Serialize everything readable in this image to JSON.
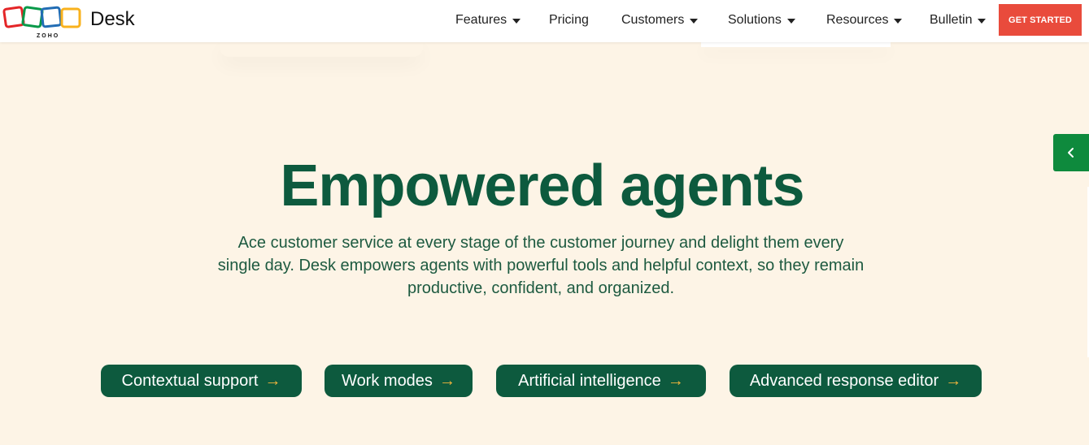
{
  "header": {
    "logo_text": "ZOHO",
    "brand": "Desk",
    "nav": [
      {
        "label": "Features",
        "has_dropdown": true
      },
      {
        "label": "Pricing",
        "has_dropdown": false
      },
      {
        "label": "Customers",
        "has_dropdown": true
      },
      {
        "label": "Solutions",
        "has_dropdown": true
      },
      {
        "label": "Resources",
        "has_dropdown": true
      },
      {
        "label": "Bulletin",
        "has_dropdown": true
      }
    ],
    "cta_label": "GET STARTED"
  },
  "side_tab": {
    "icon": "chevron-left-icon"
  },
  "hero": {
    "title": "Empowered agents",
    "description": "Ace customer service at every stage of the customer journey and delight them every single day. Desk empowers agents with powerful tools and helpful context, so they remain productive, confident, and organized."
  },
  "pills": [
    {
      "label": "Contextual support",
      "icon": "arrow-right-icon"
    },
    {
      "label": "Work modes",
      "icon": "arrow-right-icon"
    },
    {
      "label": "Artificial intelligence",
      "icon": "arrow-right-icon"
    },
    {
      "label": "Advanced response editor",
      "icon": "arrow-right-icon"
    }
  ],
  "colors": {
    "background": "#fdf4e6",
    "primary_green": "#0d5a3e",
    "cta_red": "#e94b3c",
    "side_tab_green": "#0e8a3d",
    "arrow_gold": "#f2b43c"
  }
}
